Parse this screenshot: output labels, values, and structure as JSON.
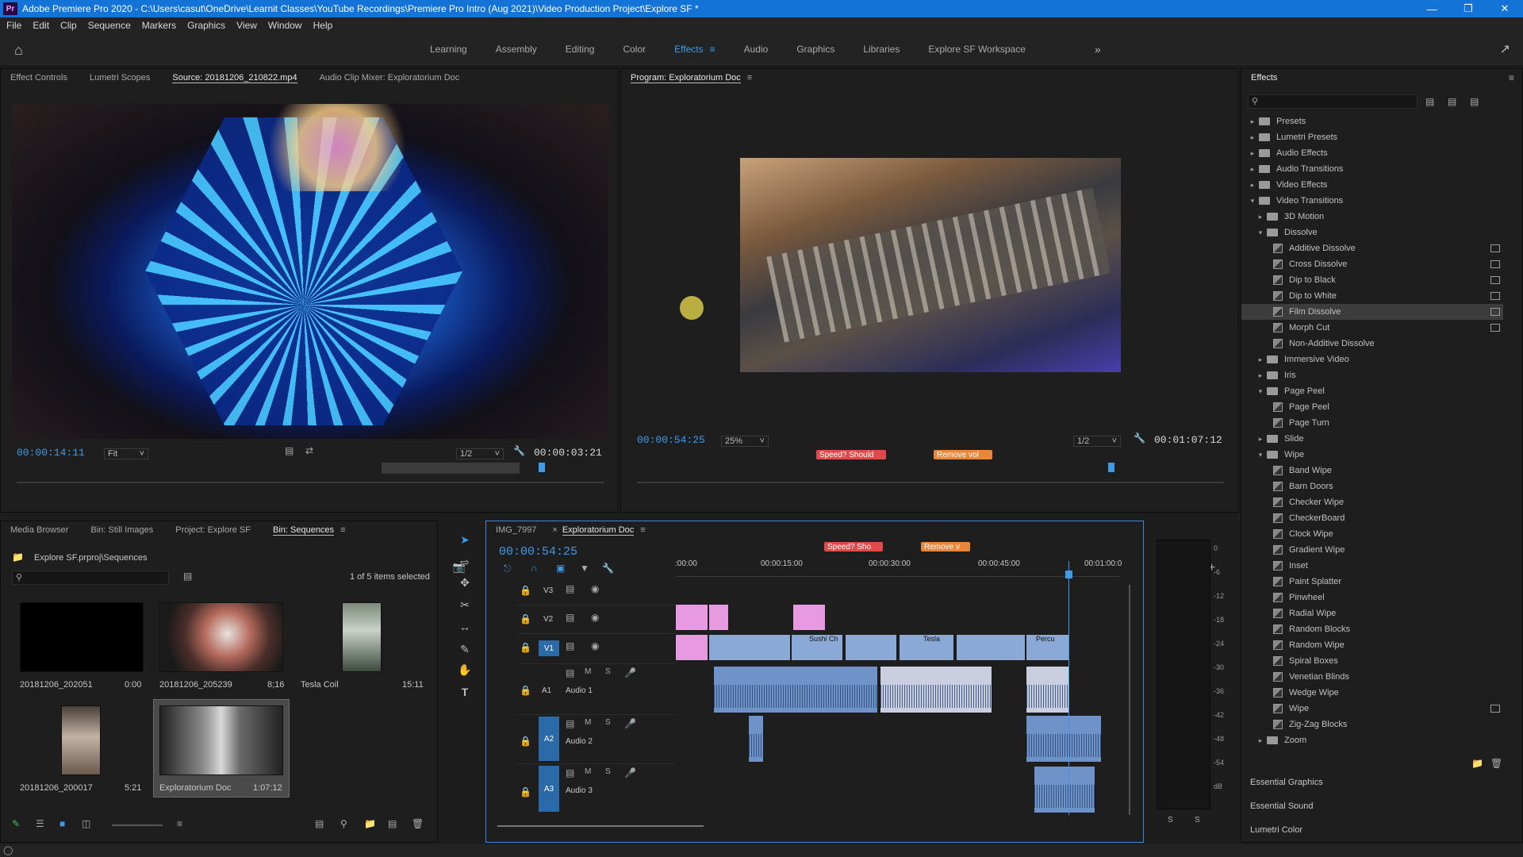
{
  "window": {
    "title": "Adobe Premiere Pro 2020 - C:\\Users\\casut\\OneDrive\\Learnit Classes\\YouTube Recordings\\Premiere Pro Intro (Aug 2021)\\Video Production Project\\Explore SF *",
    "app_icon": "Pr"
  },
  "menu": [
    "File",
    "Edit",
    "Clip",
    "Sequence",
    "Markers",
    "Graphics",
    "View",
    "Window",
    "Help"
  ],
  "workspaces": {
    "tabs": [
      "Learning",
      "Assembly",
      "Editing",
      "Color",
      "Effects",
      "Audio",
      "Graphics",
      "Libraries",
      "Explore SF Workspace"
    ],
    "active": "Effects",
    "more": "»"
  },
  "source_panel": {
    "tabs": [
      "Effect Controls",
      "Lumetri Scopes",
      "Source: 20181206_210822.mp4",
      "Audio Clip Mixer: Exploratorium Doc"
    ],
    "active_tab_index": 2,
    "timecode": "00:00:14:11",
    "fit": "Fit",
    "resolution": "1/2",
    "duration": "00:00:03:21"
  },
  "program_panel": {
    "tab": "Program: Exploratorium Doc",
    "timecode": "00:00:54:25",
    "zoom": "25%",
    "resolution": "1/2",
    "duration": "00:01:07:12",
    "markers": [
      {
        "label": "Speed? Should",
        "color": "#e04a4a"
      },
      {
        "label": "Remove vol",
        "color": "#e8873a"
      }
    ]
  },
  "effects_panel": {
    "title": "Effects",
    "tree": [
      {
        "label": "Presets",
        "level": 0,
        "type": "folder",
        "state": "closed"
      },
      {
        "label": "Lumetri Presets",
        "level": 0,
        "type": "folder",
        "state": "closed"
      },
      {
        "label": "Audio Effects",
        "level": 0,
        "type": "folder",
        "state": "closed"
      },
      {
        "label": "Audio Transitions",
        "level": 0,
        "type": "folder",
        "state": "closed"
      },
      {
        "label": "Video Effects",
        "level": 0,
        "type": "folder",
        "state": "closed"
      },
      {
        "label": "Video Transitions",
        "level": 0,
        "type": "folder",
        "state": "open"
      },
      {
        "label": "3D Motion",
        "level": 1,
        "type": "folder",
        "state": "closed"
      },
      {
        "label": "Dissolve",
        "level": 1,
        "type": "folder",
        "state": "open"
      },
      {
        "label": "Additive Dissolve",
        "level": 2,
        "type": "effect",
        "badge": true
      },
      {
        "label": "Cross Dissolve",
        "level": 2,
        "type": "effect",
        "badge": true
      },
      {
        "label": "Dip to Black",
        "level": 2,
        "type": "effect",
        "badge": true
      },
      {
        "label": "Dip to White",
        "level": 2,
        "type": "effect",
        "badge": true
      },
      {
        "label": "Film Dissolve",
        "level": 2,
        "type": "effect",
        "badge": true,
        "selected": true
      },
      {
        "label": "Morph Cut",
        "level": 2,
        "type": "effect",
        "badge": true
      },
      {
        "label": "Non-Additive Dissolve",
        "level": 2,
        "type": "effect"
      },
      {
        "label": "Immersive Video",
        "level": 1,
        "type": "folder",
        "state": "closed"
      },
      {
        "label": "Iris",
        "level": 1,
        "type": "folder",
        "state": "closed"
      },
      {
        "label": "Page Peel",
        "level": 1,
        "type": "folder",
        "state": "open"
      },
      {
        "label": "Page Peel",
        "level": 2,
        "type": "effect"
      },
      {
        "label": "Page Turn",
        "level": 2,
        "type": "effect"
      },
      {
        "label": "Slide",
        "level": 1,
        "type": "folder",
        "state": "closed"
      },
      {
        "label": "Wipe",
        "level": 1,
        "type": "folder",
        "state": "open"
      },
      {
        "label": "Band Wipe",
        "level": 2,
        "type": "effect"
      },
      {
        "label": "Barn Doors",
        "level": 2,
        "type": "effect"
      },
      {
        "label": "Checker Wipe",
        "level": 2,
        "type": "effect"
      },
      {
        "label": "CheckerBoard",
        "level": 2,
        "type": "effect"
      },
      {
        "label": "Clock Wipe",
        "level": 2,
        "type": "effect"
      },
      {
        "label": "Gradient Wipe",
        "level": 2,
        "type": "effect"
      },
      {
        "label": "Inset",
        "level": 2,
        "type": "effect"
      },
      {
        "label": "Paint Splatter",
        "level": 2,
        "type": "effect"
      },
      {
        "label": "Pinwheel",
        "level": 2,
        "type": "effect"
      },
      {
        "label": "Radial Wipe",
        "level": 2,
        "type": "effect"
      },
      {
        "label": "Random Blocks",
        "level": 2,
        "type": "effect"
      },
      {
        "label": "Random Wipe",
        "level": 2,
        "type": "effect"
      },
      {
        "label": "Spiral Boxes",
        "level": 2,
        "type": "effect"
      },
      {
        "label": "Venetian Blinds",
        "level": 2,
        "type": "effect"
      },
      {
        "label": "Wedge Wipe",
        "level": 2,
        "type": "effect"
      },
      {
        "label": "Wipe",
        "level": 2,
        "type": "effect",
        "badge": true
      },
      {
        "label": "Zig-Zag Blocks",
        "level": 2,
        "type": "effect"
      },
      {
        "label": "Zoom",
        "level": 1,
        "type": "folder",
        "state": "closed"
      }
    ],
    "footer": [
      "Essential Graphics",
      "Essential Sound",
      "Lumetri Color"
    ]
  },
  "project_panel": {
    "tabs": [
      "Media Browser",
      "Bin: Still Images",
      "Project: Explore SF",
      "Bin: Sequences"
    ],
    "active_tab_index": 3,
    "path": "Explore SF.prproj\\Sequences",
    "selection_info": "1 of 5 items selected",
    "items": [
      {
        "name": "20181206_202051",
        "duration": "0:00"
      },
      {
        "name": "20181206_205239",
        "duration": "8;16"
      },
      {
        "name": "Tesla Coil",
        "duration": "15:11"
      },
      {
        "name": "20181206_200017",
        "duration": "5:21"
      },
      {
        "name": "Exploratorium Doc",
        "duration": "1:07:12"
      }
    ]
  },
  "timeline": {
    "tabs": [
      "IMG_7997",
      "Exploratorium Doc"
    ],
    "active_tab_index": 1,
    "timecode": "00:00:54:25",
    "ruler": [
      ":00:00",
      "00:00:15:00",
      "00:00:30:00",
      "00:00:45:00",
      "00:01:00:0"
    ],
    "markers": [
      {
        "label": "Speed? Sho",
        "color": "#e04a4a"
      },
      {
        "label": "Remove v",
        "color": "#e8873a"
      }
    ],
    "tracks": [
      {
        "id": "V3",
        "name": ""
      },
      {
        "id": "V2",
        "name": ""
      },
      {
        "id": "V1",
        "name": ""
      },
      {
        "id": "A1",
        "name": "Audio 1"
      },
      {
        "id": "A2",
        "name": "Audio 2"
      },
      {
        "id": "A3",
        "name": "Audio 3"
      }
    ],
    "clip_labels": [
      "Sushi Ch",
      "Tesla",
      "Percu"
    ]
  },
  "meter": {
    "scale": [
      "0",
      "-6",
      "-12",
      "-18",
      "-24",
      "-30",
      "-36",
      "-42",
      "-48",
      "-54",
      "dB"
    ],
    "solo_labels": [
      "S",
      "S"
    ]
  }
}
